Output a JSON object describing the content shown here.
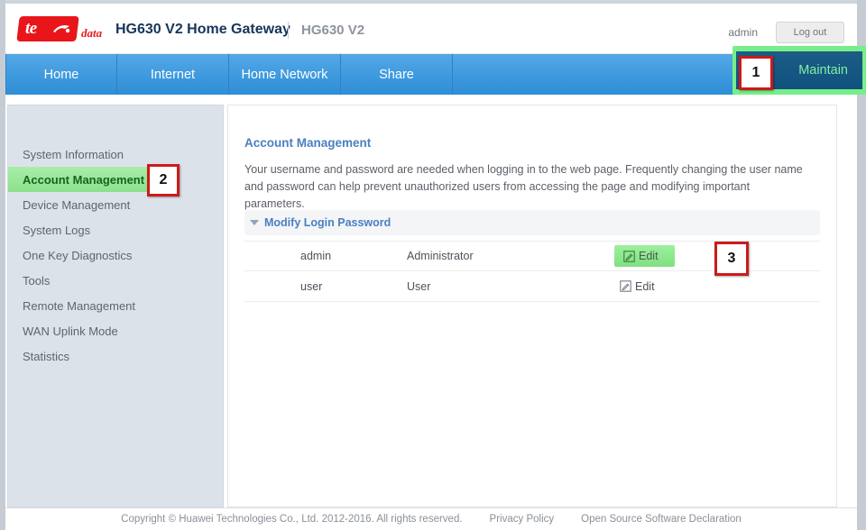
{
  "header": {
    "logo_text_primary": "te",
    "logo_text_secondary": "data",
    "logo_icon": "te-data-logo",
    "title": "HG630 V2 Home Gateway",
    "model": "HG630 V2",
    "user": "admin",
    "logout_label": "Log out"
  },
  "nav": {
    "items": [
      {
        "label": "Home"
      },
      {
        "label": "Internet"
      },
      {
        "label": "Home Network"
      },
      {
        "label": "Share"
      }
    ],
    "maintain": {
      "label": "Maintain",
      "active": true,
      "highlight_color": "#77ee8a"
    }
  },
  "sidebar": {
    "items": [
      {
        "label": "System Information",
        "active": false
      },
      {
        "label": "Account Management",
        "active": true
      },
      {
        "label": "Device Management",
        "active": false
      },
      {
        "label": "System Logs",
        "active": false
      },
      {
        "label": "One Key Diagnostics",
        "active": false
      },
      {
        "label": "Tools",
        "active": false
      },
      {
        "label": "Remote Management",
        "active": false
      },
      {
        "label": "WAN Uplink Mode",
        "active": false
      },
      {
        "label": "Statistics",
        "active": false
      }
    ]
  },
  "main": {
    "title": "Account Management",
    "description": "Your username and password are needed when logging in to the web page. Frequently changing the user name and password can help prevent unauthorized users from accessing the page and modifying important parameters.",
    "section": {
      "label": "Modify Login Password",
      "expanded": true,
      "chevron_icon": "triangle-down-icon"
    },
    "rows": [
      {
        "username": "admin",
        "role": "Administrator",
        "action_label": "Edit",
        "action_icon": "pencil-square-icon",
        "highlighted": true
      },
      {
        "username": "user",
        "role": "User",
        "action_label": "Edit",
        "action_icon": "pencil-square-icon",
        "highlighted": false
      }
    ]
  },
  "footer": {
    "copyright": "Copyright © Huawei Technologies Co., Ltd. 2012-2016. All rights reserved.",
    "privacy": "Privacy Policy",
    "opensource": "Open Source Software Declaration"
  },
  "callouts": [
    {
      "number": "1",
      "target": "maintain-tab"
    },
    {
      "number": "2",
      "target": "account-management-sidebar-item"
    },
    {
      "number": "3",
      "target": "admin-edit-button"
    }
  ],
  "colors": {
    "nav_blue": "#3f9ade",
    "accent_green": "#77ee8a",
    "callout_red": "#cc1a1a",
    "title_navy": "#15355c",
    "link_blue": "#4a7fc1",
    "logo_red": "#e8161b"
  }
}
